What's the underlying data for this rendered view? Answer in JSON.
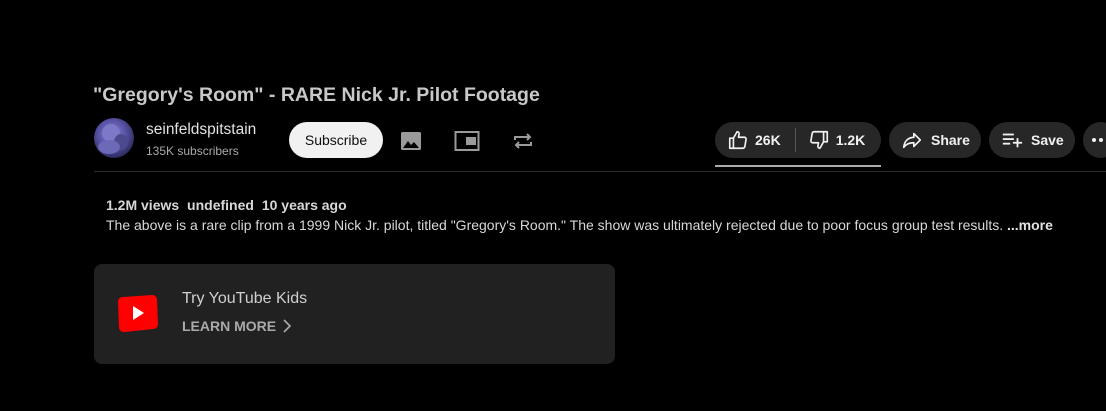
{
  "video": {
    "title": "\"Gregory's Room\" - RARE Nick Jr. Pilot Footage"
  },
  "channel": {
    "name": "seinfeldspitstain",
    "subscribers": "135K subscribers",
    "subscribe_label": "Subscribe"
  },
  "toolbar": {
    "icons": [
      "image-icon",
      "miniplayer-icon",
      "loop-icon"
    ]
  },
  "actions": {
    "likes": "26K",
    "dislikes": "1.2K",
    "share_label": "Share",
    "save_label": "Save"
  },
  "description": {
    "views": "1.2M views",
    "date_placeholder": "undefined",
    "age": "10 years ago",
    "text": "The above is a rare clip from a 1999 Nick Jr. pilot, titled \"Gregory's Room.\" The show was ultimately rejected due to poor focus group test results. ",
    "more_label": "...more"
  },
  "kids_card": {
    "title": "Try YouTube Kids",
    "learn_more": "LEARN MORE"
  },
  "colors": {
    "background": "#000000",
    "pill": "#272727",
    "card": "#212121",
    "brand_red": "#ff0000",
    "subscribe_bg": "#f1f1f1"
  }
}
